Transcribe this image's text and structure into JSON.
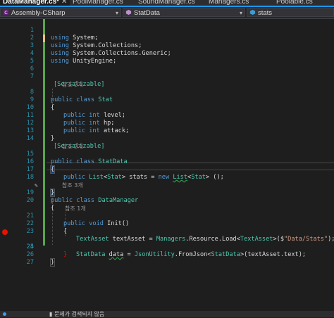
{
  "tabs": [
    {
      "label": "DataManager.cs*",
      "close": "✕",
      "active": true
    },
    {
      "label": "PoolManager.cs",
      "active": false
    },
    {
      "label": "SoundManager.cs",
      "active": false
    },
    {
      "label": "Managers.cs",
      "active": false
    },
    {
      "label": "Poolable.cs",
      "active": false
    }
  ],
  "nav": {
    "project": "Assembly-CSharp",
    "type": "StatData",
    "member": "stats"
  },
  "lenses": {
    "l7": "참조 2개",
    "l14": "참조 2개",
    "l18": "참조 3개",
    "l20": "참조 1개"
  },
  "lines": {
    "n1": "1",
    "n2": "2",
    "n3": "3",
    "n4": "4",
    "n5": "5",
    "n6": "6",
    "n7": "7",
    "n8": "8",
    "n9": "9",
    "n10": "10",
    "n11": "11",
    "n12": "12",
    "n13": "13",
    "n14": "14",
    "n15": "15",
    "n16": "16",
    "n17": "17",
    "n18": "18",
    "n19": "19",
    "n20": "20",
    "n21": "21",
    "n22": "22",
    "n23": "23",
    "n24": "24",
    "n25": "25",
    "n26": "26",
    "n27": "27"
  },
  "code": {
    "using": "using",
    "system": "System;",
    "collections": "System.Collections;",
    "generic": "System.Collections.Generic;",
    "unity": "UnityEngine;",
    "serializable": "[Serializable]",
    "public": "public",
    "class": "class",
    "stat": "Stat",
    "int": "int",
    "level": "level;",
    "hp": "hp;",
    "attack": "attack;",
    "open_brace": "{",
    "close_brace": "}",
    "statdata": "StatData",
    "list": "List",
    "lt": "<",
    "gt": ">",
    "stats_eq": "stats =",
    "new": "new",
    "list_new": "List",
    "ctor": " ();",
    "datamanager": "DataManager",
    "void": "void",
    "init": "Init()",
    "textasset": "TextAsset",
    "textasset_var": "textAsset =",
    "managers": "Managers",
    "resource_load": ".Resource.Load<",
    "textasset_gen": "TextAsset",
    "load_arg_open": ">($",
    "path": "\"Data/Stats\"",
    "load_close": ");",
    "data_var": "data",
    "eq": "=",
    "jsonutility": "JsonUtility",
    "fromjson": ".FromJson<",
    "fromjson_end": ">(textAsset.text);"
  },
  "status": {
    "text": "▮ 문제가 검색되지 않음"
  }
}
